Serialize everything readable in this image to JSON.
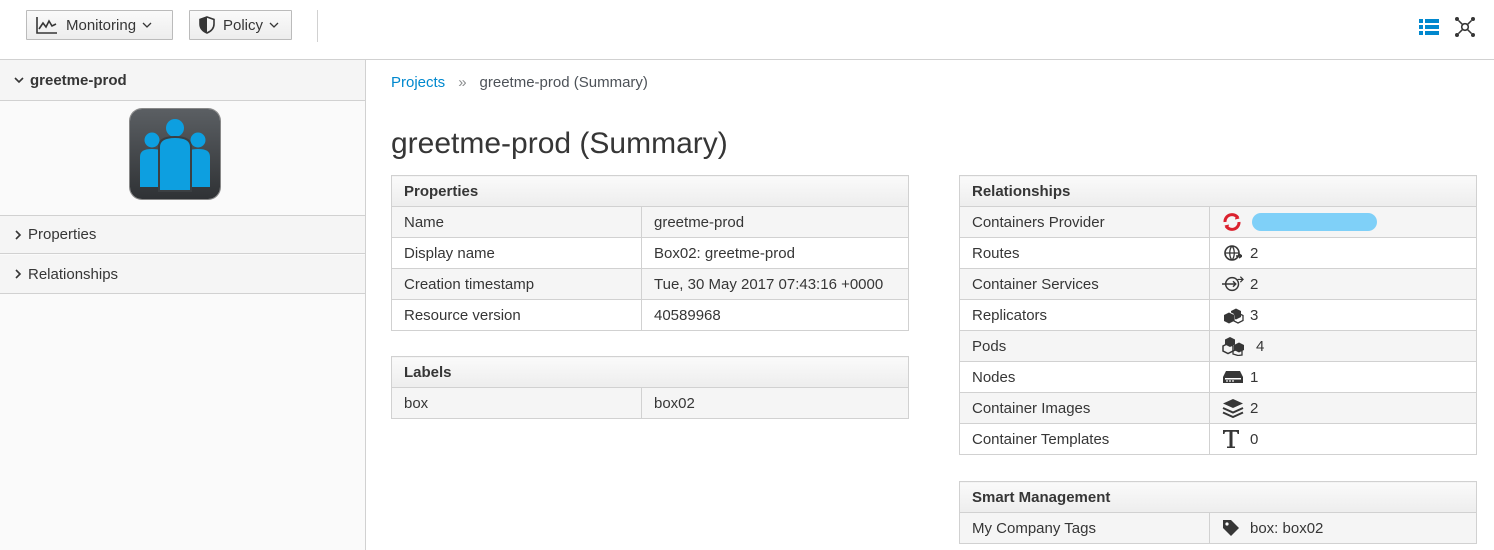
{
  "toolbar": {
    "monitoring_label": "Monitoring",
    "policy_label": "Policy"
  },
  "sidebar": {
    "project_name": "greetme-prod",
    "sections": [
      {
        "label": "Properties"
      },
      {
        "label": "Relationships"
      }
    ]
  },
  "breadcrumb": {
    "parent": "Projects",
    "separator": "»",
    "current": "greetme-prod (Summary)"
  },
  "page_title": "greetme-prod (Summary)",
  "properties": {
    "title": "Properties",
    "rows": [
      {
        "label": "Name",
        "value": "greetme-prod"
      },
      {
        "label": "Display name",
        "value": "Box02: greetme-prod"
      },
      {
        "label": "Creation timestamp",
        "value": "Tue, 30 May 2017 07:43:16 +0000"
      },
      {
        "label": "Resource version",
        "value": "40589968"
      }
    ]
  },
  "labels": {
    "title": "Labels",
    "rows": [
      {
        "label": "box",
        "value": "box02"
      }
    ]
  },
  "relationships": {
    "title": "Relationships",
    "rows": [
      {
        "label": "Containers Provider",
        "value": "",
        "icon": "openshift-icon"
      },
      {
        "label": "Routes",
        "value": "2",
        "icon": "route-icon"
      },
      {
        "label": "Container Services",
        "value": "2",
        "icon": "service-icon"
      },
      {
        "label": "Replicators",
        "value": "3",
        "icon": "replicator-icon"
      },
      {
        "label": "Pods",
        "value": "4",
        "icon": "pod-icon"
      },
      {
        "label": "Nodes",
        "value": "1",
        "icon": "node-icon"
      },
      {
        "label": "Container Images",
        "value": "2",
        "icon": "image-layers-icon"
      },
      {
        "label": "Container Templates",
        "value": "0",
        "icon": "template-icon"
      }
    ]
  },
  "smart_management": {
    "title": "Smart Management",
    "rows": [
      {
        "label": "My Company Tags",
        "value": "box: box02",
        "icon": "tag-icon"
      }
    ]
  },
  "colors": {
    "link": "#0088ce",
    "icon_blue": "#0088ce",
    "openshift_red": "#db212e"
  }
}
